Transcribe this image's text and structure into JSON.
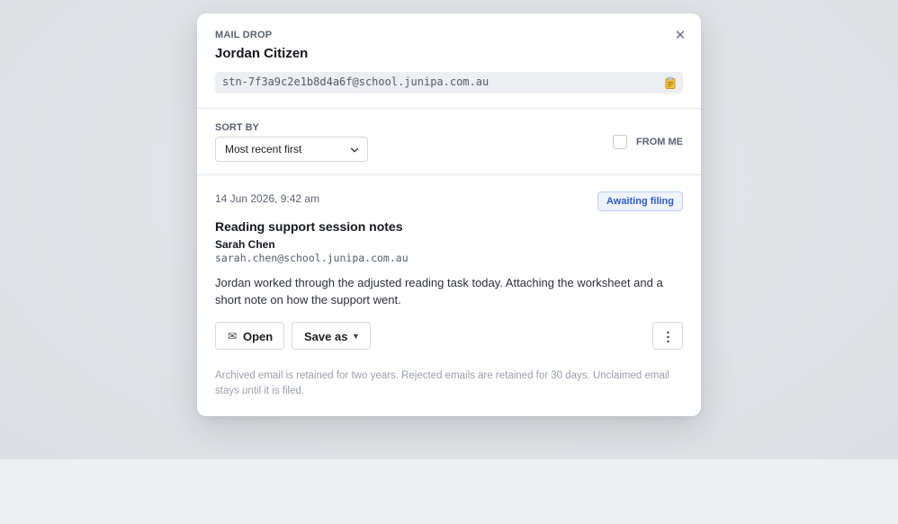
{
  "panel": {
    "eyebrow": "MAIL DROP",
    "student_name": "Jordan Citizen",
    "address": "stn-7f3a9c2e1b8d4a6f@school.junipa.com.au",
    "close_icon": "close-icon",
    "copy_icon": "clipboard-icon"
  },
  "sort": {
    "label": "SORT BY",
    "selected": "Most recent first",
    "from_me_label": "FROM ME",
    "from_me_checked": false
  },
  "message": {
    "date": "14 Jun 2026, 9:42 am",
    "status": "Awaiting filing",
    "subject": "Reading support session notes",
    "sender_name": "Sarah Chen",
    "sender_email": "sarah.chen@school.junipa.com.au",
    "body": "Jordan worked through the adjusted reading task today. Attaching the worksheet and a short note on how the support went.",
    "actions": {
      "open_icon": "✉",
      "open_label": "Open",
      "save_label": "Save as",
      "save_caret": "▼"
    }
  },
  "footnote": "Archived email is retained for two years. Rejected emails are retained for 30 days. Unclaimed email stays until it is filed.",
  "colors": {
    "badge_text": "#2c5cc5",
    "badge_bg": "#eef3fd",
    "backdrop": "#e4e6ea"
  }
}
